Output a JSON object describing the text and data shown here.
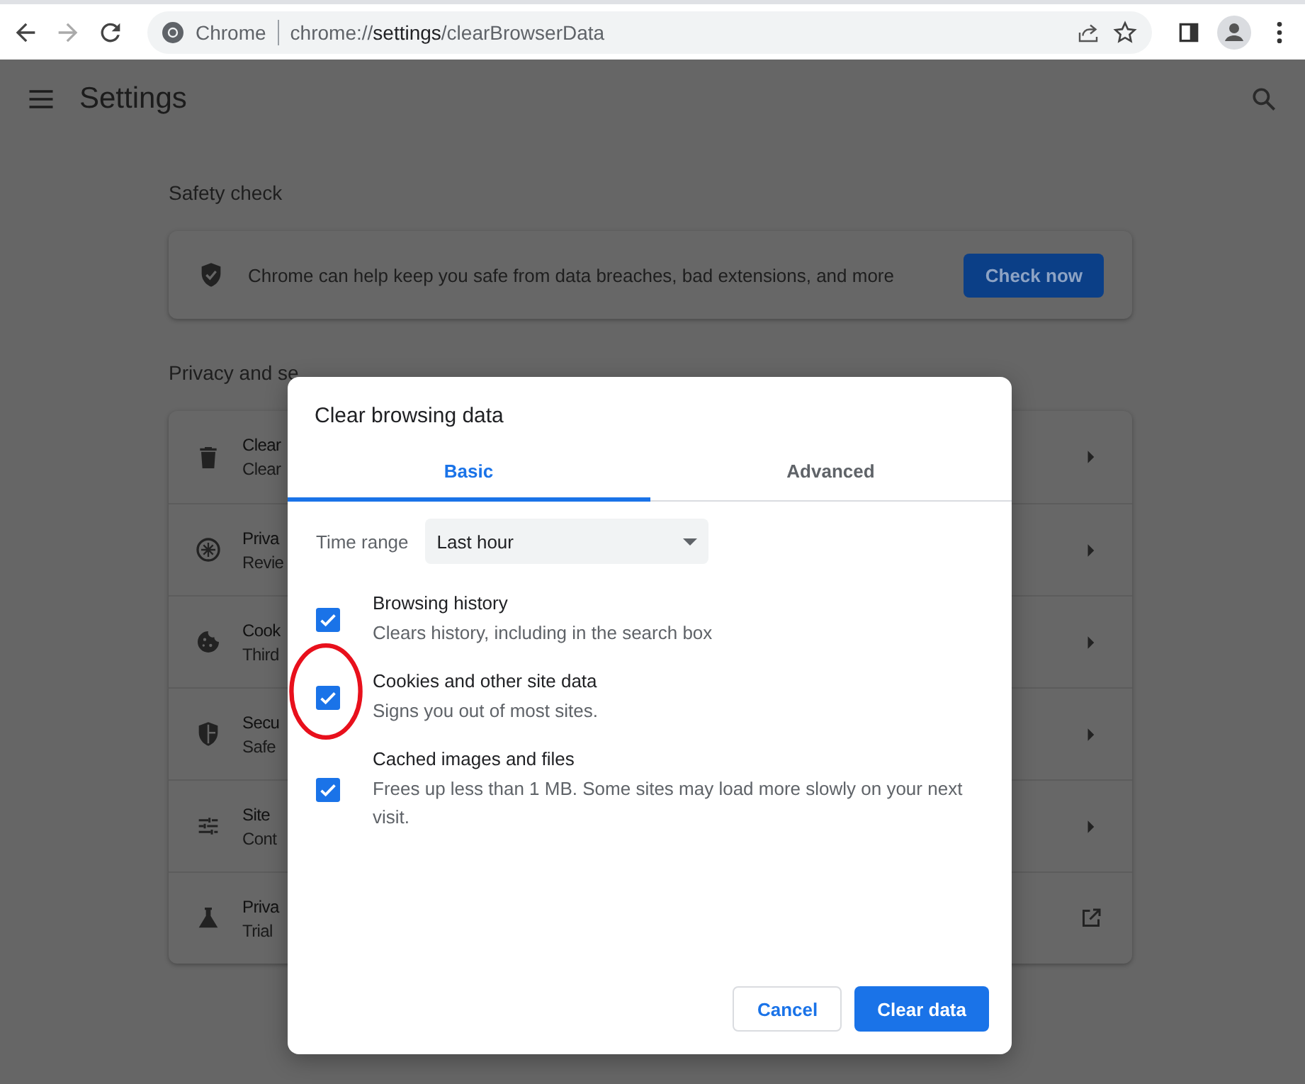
{
  "browser": {
    "omnibox": {
      "site_label": "Chrome",
      "url_scheme": "chrome://",
      "url_host": "settings",
      "url_path": "/clearBrowserData"
    }
  },
  "header": {
    "title": "Settings"
  },
  "safety_check": {
    "heading": "Safety check",
    "text": "Chrome can help keep you safe from data breaches, bad extensions, and more",
    "button": "Check now"
  },
  "privacy": {
    "heading": "Privacy and se",
    "rows": [
      {
        "title": "Clear",
        "subtitle": "Clear",
        "kind": "subpage"
      },
      {
        "title": "Priva",
        "subtitle": "Revie",
        "kind": "subpage"
      },
      {
        "title": "Cook",
        "subtitle": "Third",
        "kind": "subpage"
      },
      {
        "title": "Secu",
        "subtitle": "Safe",
        "kind": "subpage"
      },
      {
        "title": "Site",
        "subtitle": "Cont",
        "kind": "subpage"
      },
      {
        "title": "Priva",
        "subtitle": "Trial",
        "kind": "external"
      }
    ]
  },
  "dialog": {
    "title": "Clear browsing data",
    "tabs": [
      {
        "label": "Basic",
        "selected": true
      },
      {
        "label": "Advanced",
        "selected": false
      }
    ],
    "time_range": {
      "label": "Time range",
      "value": "Last hour"
    },
    "options": [
      {
        "title": "Browsing history",
        "description": "Clears history, including in the search box",
        "checked": true
      },
      {
        "title": "Cookies and other site data",
        "description": "Signs you out of most sites.",
        "checked": true
      },
      {
        "title": "Cached images and files",
        "description": "Frees up less than 1 MB. Some sites may load more slowly on your next visit.",
        "checked": true
      }
    ],
    "buttons": [
      {
        "label": "Cancel",
        "kind": "secondary"
      },
      {
        "label": "Clear data",
        "kind": "primary"
      }
    ]
  }
}
